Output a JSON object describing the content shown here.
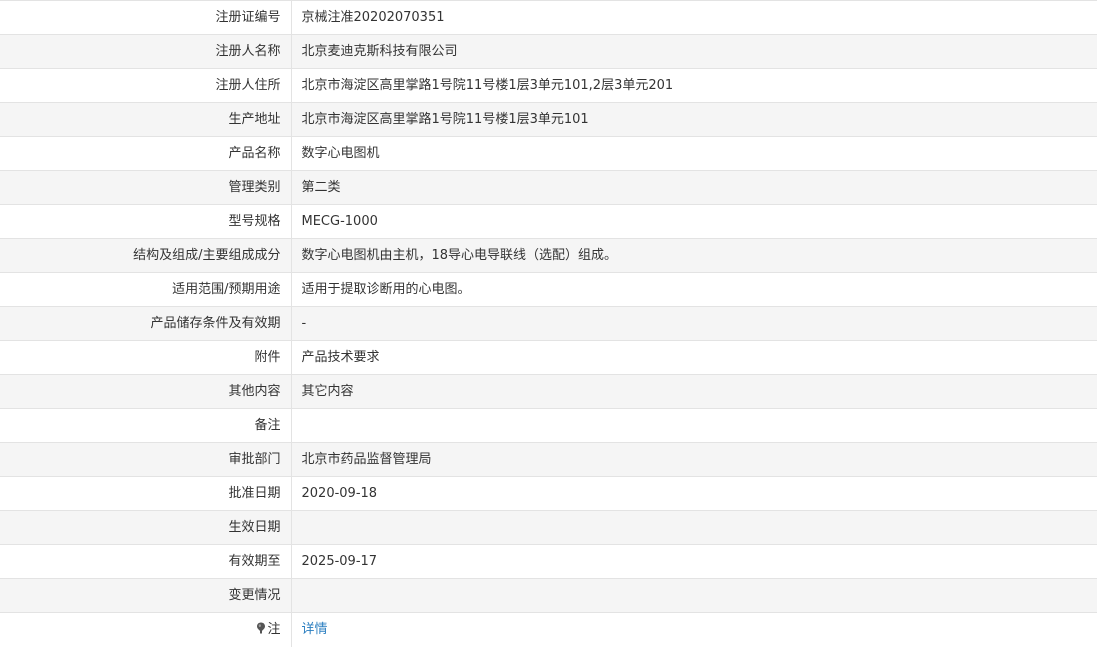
{
  "rows": [
    {
      "label": "注册证编号",
      "value": "京械注准20202070351"
    },
    {
      "label": "注册人名称",
      "value": "北京麦迪克斯科技有限公司"
    },
    {
      "label": "注册人住所",
      "value": "北京市海淀区高里掌路1号院11号楼1层3单元101,2层3单元201"
    },
    {
      "label": "生产地址",
      "value": "北京市海淀区高里掌路1号院11号楼1层3单元101"
    },
    {
      "label": "产品名称",
      "value": "数字心电图机"
    },
    {
      "label": "管理类别",
      "value": "第二类"
    },
    {
      "label": "型号规格",
      "value": "MECG-1000"
    },
    {
      "label": "结构及组成/主要组成成分",
      "value": "数字心电图机由主机，18导心电导联线（选配）组成。"
    },
    {
      "label": "适用范围/预期用途",
      "value": "适用于提取诊断用的心电图。"
    },
    {
      "label": "产品储存条件及有效期",
      "value": "-"
    },
    {
      "label": "附件",
      "value": "产品技术要求"
    },
    {
      "label": "其他内容",
      "value": "其它内容"
    },
    {
      "label": "备注",
      "value": ""
    },
    {
      "label": "审批部门",
      "value": "北京市药品监督管理局"
    },
    {
      "label": "批准日期",
      "value": "2020-09-18"
    },
    {
      "label": "生效日期",
      "value": ""
    },
    {
      "label": "有效期至",
      "value": "2025-09-17"
    },
    {
      "label": "变更情况",
      "value": ""
    }
  ],
  "note_row": {
    "label": "注",
    "icon": "pin-icon",
    "link_text": "详情"
  },
  "colors": {
    "label_bg_alt": "#f5f5f5",
    "border": "#e3e3e3",
    "text": "#333333",
    "link": "#2a7ec0"
  }
}
